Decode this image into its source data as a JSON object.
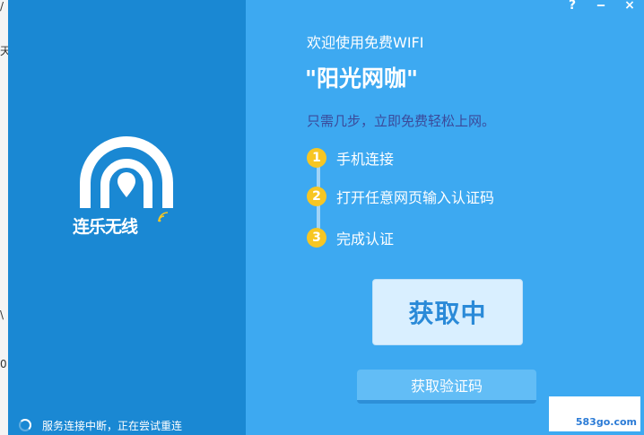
{
  "background_window": {
    "fragments": [
      "/",
      "天",
      "\\",
      "0"
    ]
  },
  "window": {
    "controls": {
      "help": "?",
      "minimize": "‒",
      "close": "×"
    }
  },
  "left_panel": {
    "logo_text": "连乐无线",
    "status_text": "服务连接中断，正在尝试重连"
  },
  "main": {
    "welcome": "欢迎使用免费WIFI",
    "cafe_name": "\"阳光网咖\"",
    "subtitle": "只需几步，立即免费轻松上网。",
    "steps": [
      {
        "num": "1",
        "label": "手机连接"
      },
      {
        "num": "2",
        "label": "打开任意网页输入认证码"
      },
      {
        "num": "3",
        "label": "完成认证"
      }
    ],
    "status_button": "获取中",
    "code_button": "获取验证码"
  },
  "watermark": "583go.com",
  "colors": {
    "left_panel": "#1a88d3",
    "right_panel": "#3da9f1",
    "step_badge": "#f7c623",
    "subtitle": "#3b4a9a"
  }
}
